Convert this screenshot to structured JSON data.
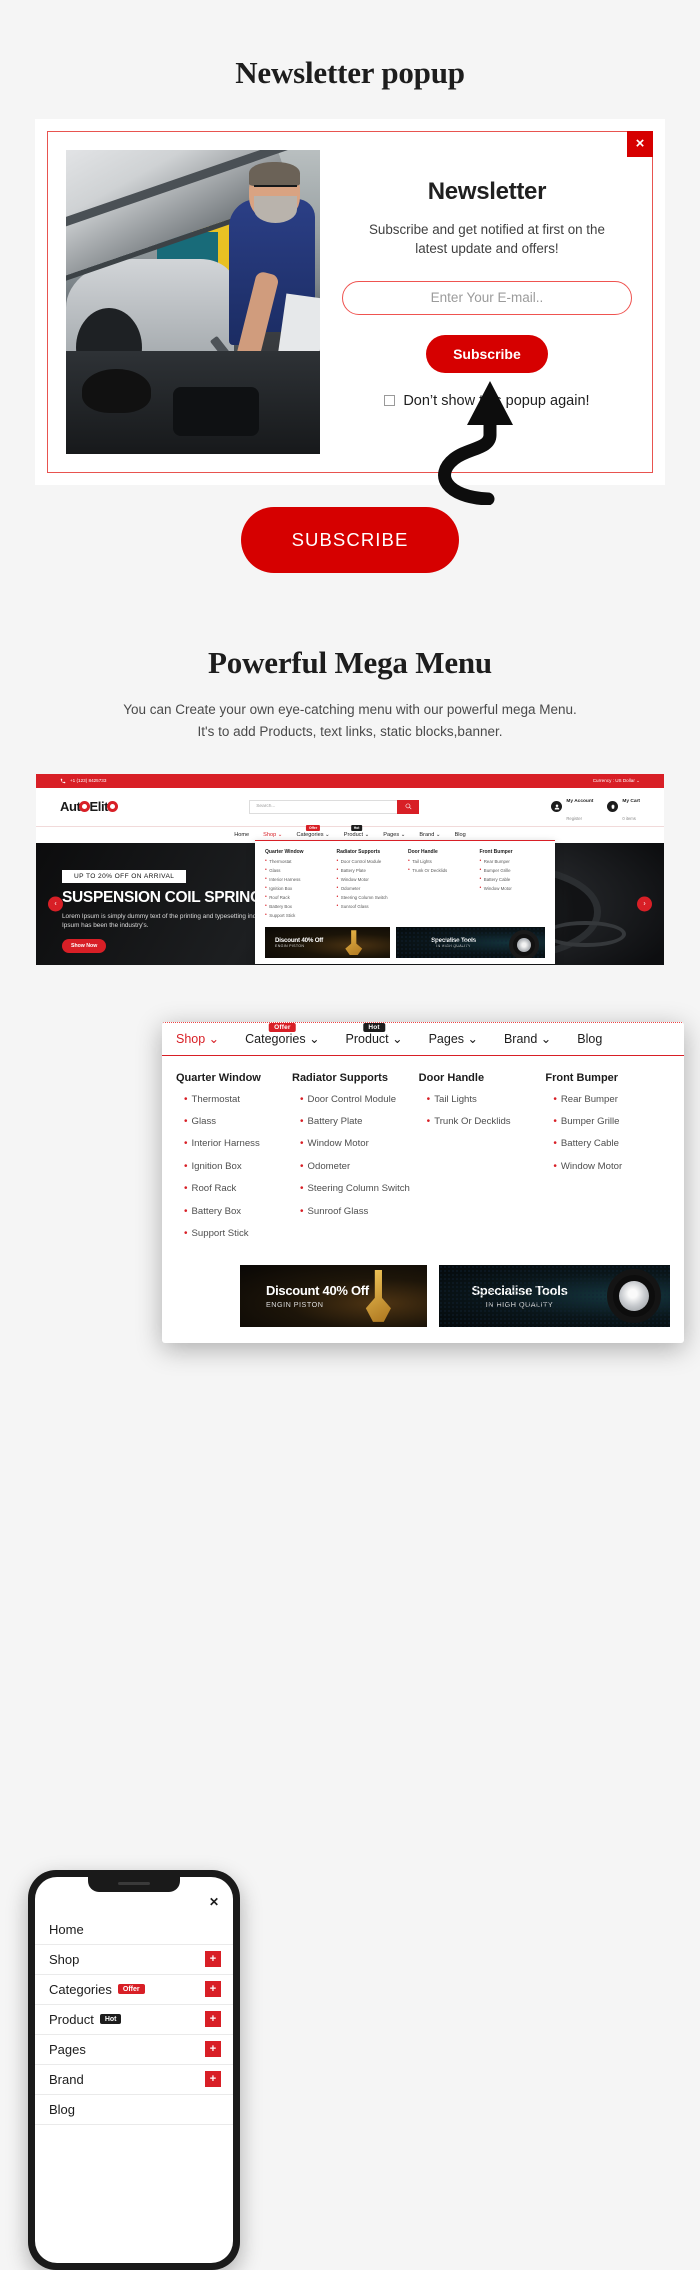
{
  "sections": {
    "newsletter_title": "Newsletter popup",
    "mega_title": "Powerful Mega Menu",
    "mega_sub_line1": "You can Create your own eye-catching menu with our powerful mega Menu.",
    "mega_sub_line2": "It's to add Products, text links, static blocks,banner."
  },
  "popup": {
    "close_label": "×",
    "heading": "Newsletter",
    "description": "Subscribe and get notified at first on the latest update and offers!",
    "email_value": "",
    "email_placeholder": "Enter Your E-mail..",
    "subscribe_label": "Subscribe",
    "dont_show_label": "Don’t show this popup again!"
  },
  "big_button": {
    "label": "SUBSCRIBE"
  },
  "site": {
    "topbar": {
      "phone": "+1 (123) 8425733",
      "currency": "Currency : US Dollar"
    },
    "logo": {
      "part1": "Aut",
      "part2": "Elit"
    },
    "search": {
      "value": "",
      "placeholder": "Search..."
    },
    "account": {
      "title": "My Account",
      "sub": "Register"
    },
    "cart": {
      "title": "My Cart",
      "sub": "0 items"
    },
    "nav": [
      {
        "label": "Home",
        "caret": "",
        "badge": "",
        "badge_type": "",
        "active": false
      },
      {
        "label": "Shop",
        "caret": "⌄",
        "badge": "",
        "badge_type": "",
        "active": true
      },
      {
        "label": "Categories",
        "caret": "⌄",
        "badge": "Offer",
        "badge_type": "offer",
        "active": false
      },
      {
        "label": "Product",
        "caret": "⌄",
        "badge": "Hot",
        "badge_type": "hot",
        "active": false
      },
      {
        "label": "Pages",
        "caret": "⌄",
        "badge": "",
        "badge_type": "",
        "active": false
      },
      {
        "label": "Brand",
        "caret": "⌄",
        "badge": "",
        "badge_type": "",
        "active": false
      },
      {
        "label": "Blog",
        "caret": "",
        "badge": "",
        "badge_type": "",
        "active": false
      }
    ],
    "hero": {
      "tag": "UP TO 20% OFF ON ARRIVAL",
      "title": "SUSPENSION COIL SPRING",
      "paragraph": "Lorem Ipsum is simply dummy text of the printing and typesetting industry. Lorem Ipsum has been the industry's.",
      "button": "Show Now",
      "prev": "‹",
      "next": "›"
    }
  },
  "megamenu": {
    "columns": [
      {
        "heading": "Quarter Window",
        "items": [
          "Thermostat",
          "Glass",
          "Interior Harness",
          "Ignition Box",
          "Roof Rack",
          "Battery Box",
          "Support Stick"
        ]
      },
      {
        "heading": "Radiator Supports",
        "items": [
          "Door Control Module",
          "Battery Plate",
          "Window Motor",
          "Odometer",
          "Steering Column Switch",
          "Sunroof Glass"
        ]
      },
      {
        "heading": "Door Handle",
        "items": [
          "Tail Lights",
          "Trunk Or Decklids"
        ]
      },
      {
        "heading": "Front Bumper",
        "items": [
          "Rear Bumper",
          "Bumper Grille",
          "Battery Cable",
          "Window Motor"
        ]
      }
    ],
    "banners": [
      {
        "title": "Discount 40% Off",
        "sub": "ENGIN PISTON"
      },
      {
        "title": "Specialise Tools",
        "sub": "IN HIGH QUALITY"
      }
    ]
  },
  "phone": {
    "close_label": "✕",
    "items": [
      {
        "label": "Home",
        "badge": "",
        "badge_type": "",
        "plus": ""
      },
      {
        "label": "Shop",
        "badge": "",
        "badge_type": "",
        "plus": "+"
      },
      {
        "label": "Categories",
        "badge": "Offer",
        "badge_type": "offer",
        "plus": "+"
      },
      {
        "label": "Product",
        "badge": "Hot",
        "badge_type": "hot",
        "plus": "+"
      },
      {
        "label": "Pages",
        "badge": "",
        "badge_type": "",
        "plus": "+"
      },
      {
        "label": "Brand",
        "badge": "",
        "badge_type": "",
        "plus": "+"
      },
      {
        "label": "Blog",
        "badge": "",
        "badge_type": "",
        "plus": ""
      }
    ]
  },
  "colors": {
    "accent": "#d60000",
    "brand_red": "#d81f26",
    "dark": "#1c1c1c",
    "page_bg": "#f5f5f5"
  }
}
